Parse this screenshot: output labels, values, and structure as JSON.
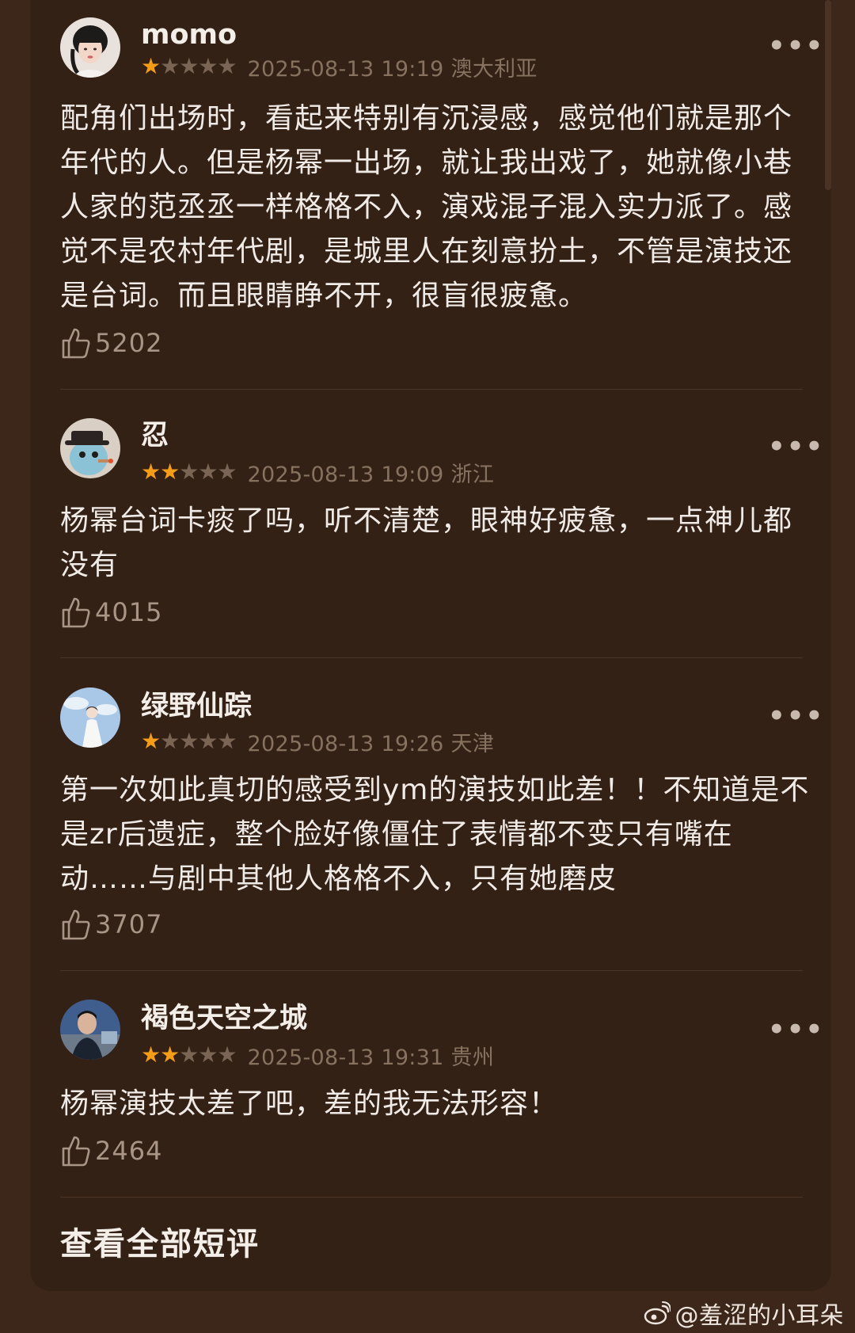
{
  "colors": {
    "background": "#3d271a",
    "panel": "#342116",
    "star_active": "#f59d19",
    "star_inactive": "#7a6555",
    "meta_text": "#86725f"
  },
  "comments": [
    {
      "username": "momo",
      "rating": 1,
      "meta": "2025-08-13 19:19 澳大利亚",
      "text": "配角们出场时，看起来特别有沉浸感，感觉他们就是那个年代的人。但是杨幂一出场，就让我出戏了，她就像小巷人家的范丞丞一样格格不入，演戏混子混入实力派了。感觉不是农村年代剧，是城里人在刻意扮土，不管是演技还是台词。而且眼睛睁不开，很盲很疲惫。",
      "likes": "5202",
      "more_icon": "more-dots-icon",
      "avatar_icon": "avatar-photo-woman"
    },
    {
      "username": "忍",
      "rating": 2,
      "meta": "2025-08-13 19:09 浙江",
      "text": "杨幂台词卡痰了吗，听不清楚，眼神好疲惫，一点神儿都没有",
      "likes": "4015",
      "more_icon": "more-dots-icon",
      "avatar_icon": "avatar-cartoon-hat"
    },
    {
      "username": "绿野仙踪",
      "rating": 1,
      "meta": "2025-08-13 19:26 天津",
      "text": "第一次如此真切的感受到ym的演技如此差！！不知道是不是zr后遗症，整个脸好像僵住了表情都不变只有嘴在动……与剧中其他人格格不入，只有她磨皮",
      "likes": "3707",
      "more_icon": "more-dots-icon",
      "avatar_icon": "avatar-sky-figure"
    },
    {
      "username": "褐色天空之城",
      "rating": 2,
      "meta": "2025-08-13 19:31 贵州",
      "text": "杨幂演技太差了吧，差的我无法形容！",
      "likes": "2464",
      "more_icon": "more-dots-icon",
      "avatar_icon": "avatar-man-portrait"
    }
  ],
  "more_label": "•••",
  "view_all": "查看全部短评",
  "watermark": "@羞涩的小耳朵",
  "watermark_icon": "weibo-logo-icon",
  "like_icon": "thumbs-up-icon",
  "star_glyph": "★"
}
